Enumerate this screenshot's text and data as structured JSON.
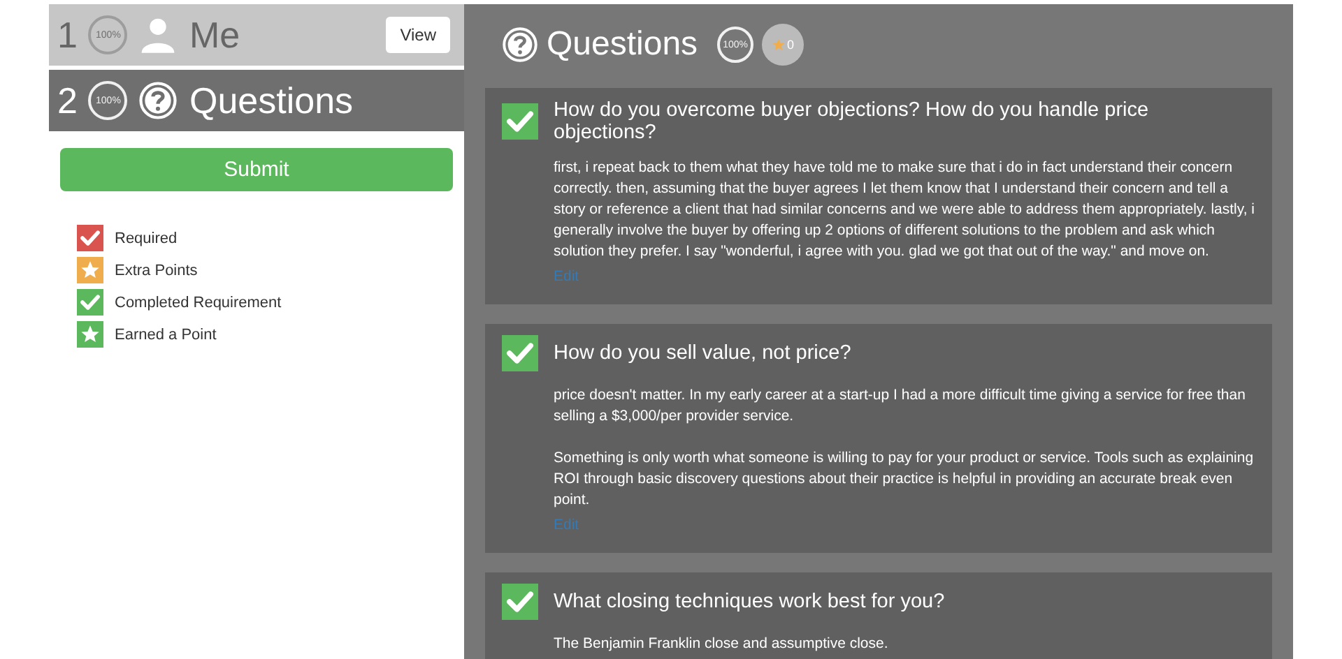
{
  "steps": [
    {
      "number": "1",
      "progress": "100%",
      "kind": "person",
      "label": "Me",
      "selected": false,
      "button": "View"
    },
    {
      "number": "2",
      "progress": "100%",
      "kind": "question",
      "label": "Questions",
      "selected": true
    }
  ],
  "submit": "Submit",
  "legend": [
    {
      "kind": "check",
      "color": "#d9534f",
      "label": "Required"
    },
    {
      "kind": "star",
      "color": "#f0ad4e",
      "label": "Extra Points"
    },
    {
      "kind": "check",
      "color": "#5cb85c",
      "label": "Completed Requirement"
    },
    {
      "kind": "star",
      "color": "#5cb85c",
      "label": "Earned a Point"
    }
  ],
  "main": {
    "title": "Questions",
    "progress": "100%",
    "points": "0"
  },
  "questions": [
    {
      "completed": true,
      "question": "How do you overcome buyer objections? How do you handle price objections?",
      "answer": [
        "first, i repeat back to them what they have told me to make sure that i do in fact understand their concern correctly. then, assuming that the buyer agrees I let them know that I understand their concern and tell a story or reference a client that had similar concerns and we were able to address them appropriately. lastly, i generally involve the buyer by offering up 2 options of different solutions to the problem and ask which solution they prefer. I say \"wonderful, i agree with you. glad we got that out of the way.\" and move on."
      ],
      "edit": "Edit"
    },
    {
      "completed": true,
      "question": "How do you sell value, not price?",
      "answer": [
        "price doesn't matter. In my early career at a start-up I had a more difficult time giving a service for free than selling a $3,000/per provider service.",
        "Something is only worth what someone is willing to pay for your product or service. Tools such as explaining ROI through basic discovery questions about their practice is helpful in providing an accurate break even point."
      ],
      "edit": "Edit"
    },
    {
      "completed": true,
      "question": "What closing techniques work best for you?",
      "answer": [
        "The Benjamin Franklin close and assumptive close."
      ]
    }
  ]
}
